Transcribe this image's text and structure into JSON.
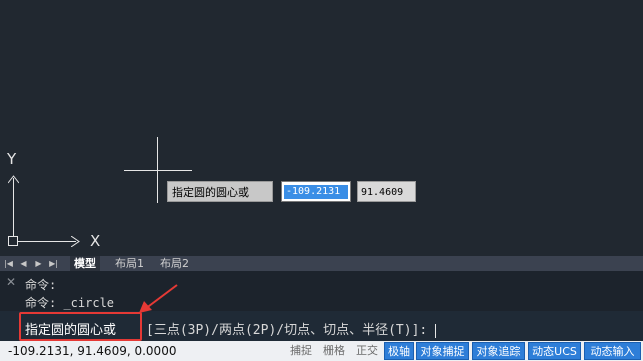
{
  "drawing_area": {
    "ucs": {
      "y_label": "Y",
      "x_label": "X"
    },
    "dynamic_input": {
      "prompt": "指定圆的圆心或",
      "x_value": "-109.2131",
      "y_value": "91.4609"
    }
  },
  "layout_tabs": {
    "nav_buttons": [
      "|◀",
      "◀",
      "▶",
      "▶|"
    ],
    "tabs": [
      {
        "label": "模型",
        "active": true
      },
      {
        "label": "布局1",
        "active": false
      },
      {
        "label": "布局2",
        "active": false
      }
    ]
  },
  "command_line": {
    "history": [
      "命令:",
      "命令: _circle"
    ],
    "current_prompt": "指定圆的圆心或",
    "current_options": "[三点(3P)/两点(2P)/切点、切点、半径(T)]:"
  },
  "status_bar": {
    "coordinates": "-109.2131, 91.4609, 0.0000",
    "toggles_off": [
      "捕捉",
      "栅格",
      "正交"
    ],
    "toggles_on": [
      "极轴",
      "对象捕捉",
      "对象追踪",
      "动态UCS",
      "动态输入"
    ]
  },
  "colors": {
    "canvas_bg": "#212830",
    "highlight": "#e53935",
    "status_active": "#2e7ed8"
  }
}
